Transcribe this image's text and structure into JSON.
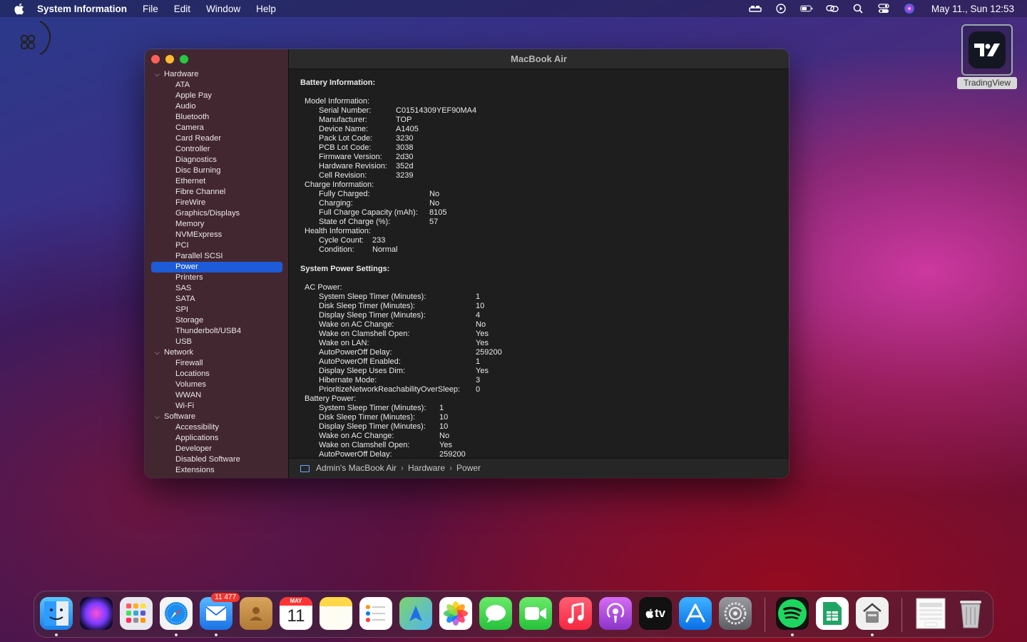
{
  "menubar": {
    "app_name": "System Information",
    "menus": [
      "File",
      "Edit",
      "Window",
      "Help"
    ],
    "clock": "May 11., Sun 12:53"
  },
  "desktop": {
    "tradingview_label": "TradingView"
  },
  "window": {
    "title": "MacBook Air",
    "sidebar": {
      "hardware": {
        "label": "Hardware",
        "items": [
          "ATA",
          "Apple Pay",
          "Audio",
          "Bluetooth",
          "Camera",
          "Card Reader",
          "Controller",
          "Diagnostics",
          "Disc Burning",
          "Ethernet",
          "Fibre Channel",
          "FireWire",
          "Graphics/Displays",
          "Memory",
          "NVMExpress",
          "PCI",
          "Parallel SCSI",
          "Power",
          "Printers",
          "SAS",
          "SATA",
          "SPI",
          "Storage",
          "Thunderbolt/USB4",
          "USB"
        ]
      },
      "network": {
        "label": "Network",
        "items": [
          "Firewall",
          "Locations",
          "Volumes",
          "WWAN",
          "Wi-Fi"
        ]
      },
      "software": {
        "label": "Software",
        "items": [
          "Accessibility",
          "Applications",
          "Developer",
          "Disabled Software",
          "Extensions"
        ]
      },
      "selected": "Power"
    },
    "battery": {
      "heading": "Battery Information:",
      "model_info": {
        "label": "Model Information:",
        "rows": [
          {
            "k": "Serial Number:",
            "v": "C01514309YEF90MA4"
          },
          {
            "k": "Manufacturer:",
            "v": "TOP"
          },
          {
            "k": "Device Name:",
            "v": "A1405"
          },
          {
            "k": "Pack Lot Code:",
            "v": "3230"
          },
          {
            "k": "PCB Lot Code:",
            "v": "3038"
          },
          {
            "k": "Firmware Version:",
            "v": "2d30"
          },
          {
            "k": "Hardware Revision:",
            "v": "352d"
          },
          {
            "k": "Cell Revision:",
            "v": "3239"
          }
        ]
      },
      "charge_info": {
        "label": "Charge Information:",
        "rows": [
          {
            "k": "Fully Charged:",
            "v": "No"
          },
          {
            "k": "Charging:",
            "v": "No"
          },
          {
            "k": "Full Charge Capacity (mAh):",
            "v": "8105"
          },
          {
            "k": "State of Charge (%):",
            "v": "57"
          }
        ]
      },
      "health_info": {
        "label": "Health Information:",
        "rows": [
          {
            "k": "Cycle Count:",
            "v": "233"
          },
          {
            "k": "Condition:",
            "v": "Normal"
          }
        ]
      }
    },
    "power": {
      "heading": "System Power Settings:",
      "ac": {
        "label": "AC Power:",
        "rows": [
          {
            "k": "System Sleep Timer (Minutes):",
            "v": "1"
          },
          {
            "k": "Disk Sleep Timer (Minutes):",
            "v": "10"
          },
          {
            "k": "Display Sleep Timer (Minutes):",
            "v": "4"
          },
          {
            "k": "Wake on AC Change:",
            "v": "No"
          },
          {
            "k": "Wake on Clamshell Open:",
            "v": "Yes"
          },
          {
            "k": "Wake on LAN:",
            "v": "Yes"
          },
          {
            "k": "AutoPowerOff Delay:",
            "v": "259200"
          },
          {
            "k": "AutoPowerOff Enabled:",
            "v": "1"
          },
          {
            "k": "Display Sleep Uses Dim:",
            "v": "Yes"
          },
          {
            "k": "Hibernate Mode:",
            "v": "3"
          },
          {
            "k": "PrioritizeNetworkReachabilityOverSleep:",
            "v": "0"
          }
        ]
      },
      "battery_power": {
        "label": "Battery Power:",
        "rows": [
          {
            "k": "System Sleep Timer (Minutes):",
            "v": "1"
          },
          {
            "k": "Disk Sleep Timer (Minutes):",
            "v": "10"
          },
          {
            "k": "Display Sleep Timer (Minutes):",
            "v": "10"
          },
          {
            "k": "Wake on AC Change:",
            "v": "No"
          },
          {
            "k": "Wake on Clamshell Open:",
            "v": "Yes"
          },
          {
            "k": "AutoPowerOff Delay:",
            "v": "259200"
          }
        ]
      }
    },
    "pathbar": [
      "Admin's MacBook Air",
      "Hardware",
      "Power"
    ]
  },
  "dock": {
    "mail_badge": "11 477",
    "calendar_month": "MAY",
    "calendar_day": "11",
    "tv_label": "tv",
    "apps": [
      "finder",
      "siri",
      "launchpad",
      "safari",
      "mail",
      "contacts",
      "calendar",
      "notes",
      "reminders",
      "maps",
      "photos",
      "messages",
      "facetime",
      "music",
      "podcasts",
      "apple-tv",
      "app-store",
      "system-preferences",
      "spotify",
      "google-sheets",
      "system-information",
      "xlsx-file",
      "trash"
    ]
  }
}
